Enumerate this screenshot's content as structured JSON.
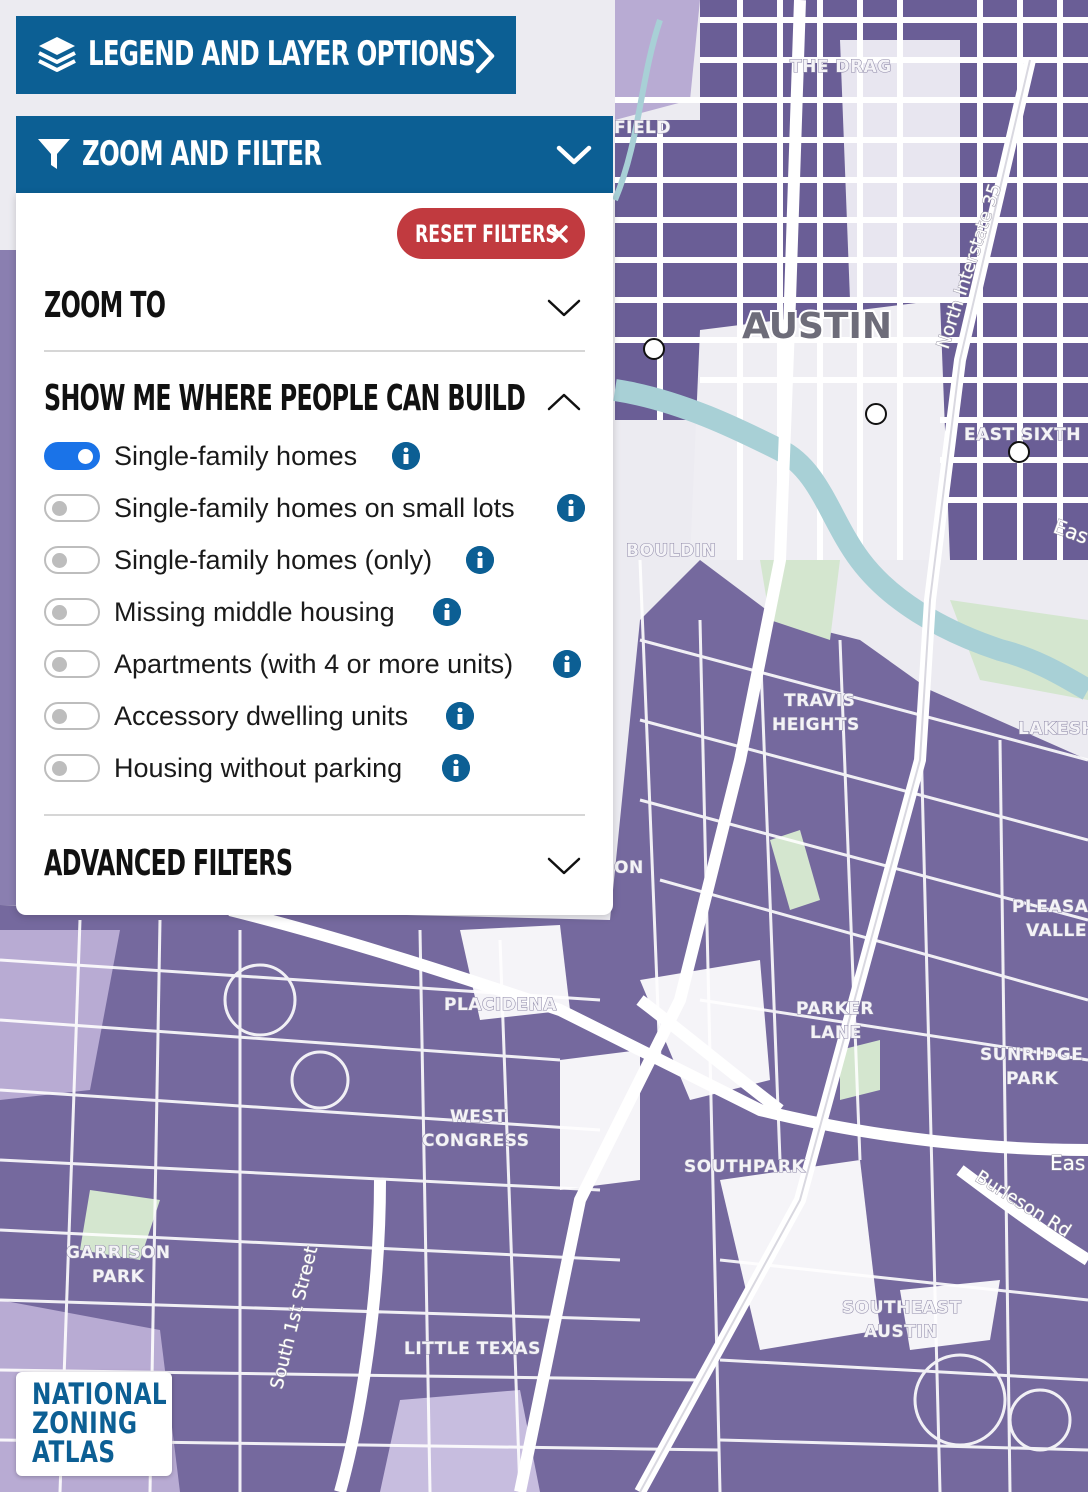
{
  "legend_bar": {
    "title": "LEGEND AND LAYER OPTIONS",
    "icon": "layers-icon",
    "action_icon": "chevron-right-icon"
  },
  "filter_bar": {
    "title": "ZOOM AND FILTER",
    "icon": "filter-funnel-icon",
    "action_icon": "chevron-down-icon"
  },
  "panel": {
    "reset_label": "RESET FILTERS",
    "reset_icon": "close-icon",
    "sections": {
      "zoom_to": {
        "title": "ZOOM TO",
        "expanded": false
      },
      "build": {
        "title": "SHOW ME WHERE PEOPLE CAN BUILD",
        "expanded": true
      },
      "advanced": {
        "title": "ADVANCED FILTERS",
        "expanded": false
      }
    },
    "options": [
      {
        "label": "Single-family homes",
        "on": true
      },
      {
        "label": "Single-family homes on small lots",
        "on": false
      },
      {
        "label": "Single-family homes (only)",
        "on": false
      },
      {
        "label": "Missing middle housing",
        "on": false
      },
      {
        "label": "Apartments (with 4 or more units)",
        "on": false
      },
      {
        "label": "Accessory dwelling units",
        "on": false
      },
      {
        "label": "Housing without parking",
        "on": false
      }
    ]
  },
  "map": {
    "city_label": "AUSTIN",
    "place_labels": [
      "THE DRAG",
      "EAST SIXTH",
      "BOULDIN",
      "TRAVIS",
      "HEIGHTS",
      "LAKESH",
      "PLEASA",
      "VALLE",
      "PLACIDENA",
      "PARKER",
      "LANE",
      "SUNRIDGE",
      "PARK",
      "WEST",
      "CONGRESS",
      "SOUTHPARK",
      "GARRISON",
      "PARK",
      "SOUTHEAST",
      "AUSTIN",
      "LITTLE TEXAS",
      "FIELD",
      "ON"
    ],
    "street_labels": [
      "North Interstate 35",
      "South 1st Street",
      "Burleson Rd",
      "Eas",
      "Eas"
    ],
    "colors": {
      "zoning": "#75699e",
      "zoning_light": "#b8abd3",
      "road": "#ffffff",
      "water": "#a8d0d6",
      "park": "#d4e6cf"
    }
  },
  "logo": {
    "lines": [
      "NATIONAL",
      "ZONING",
      "ATLAS"
    ]
  }
}
